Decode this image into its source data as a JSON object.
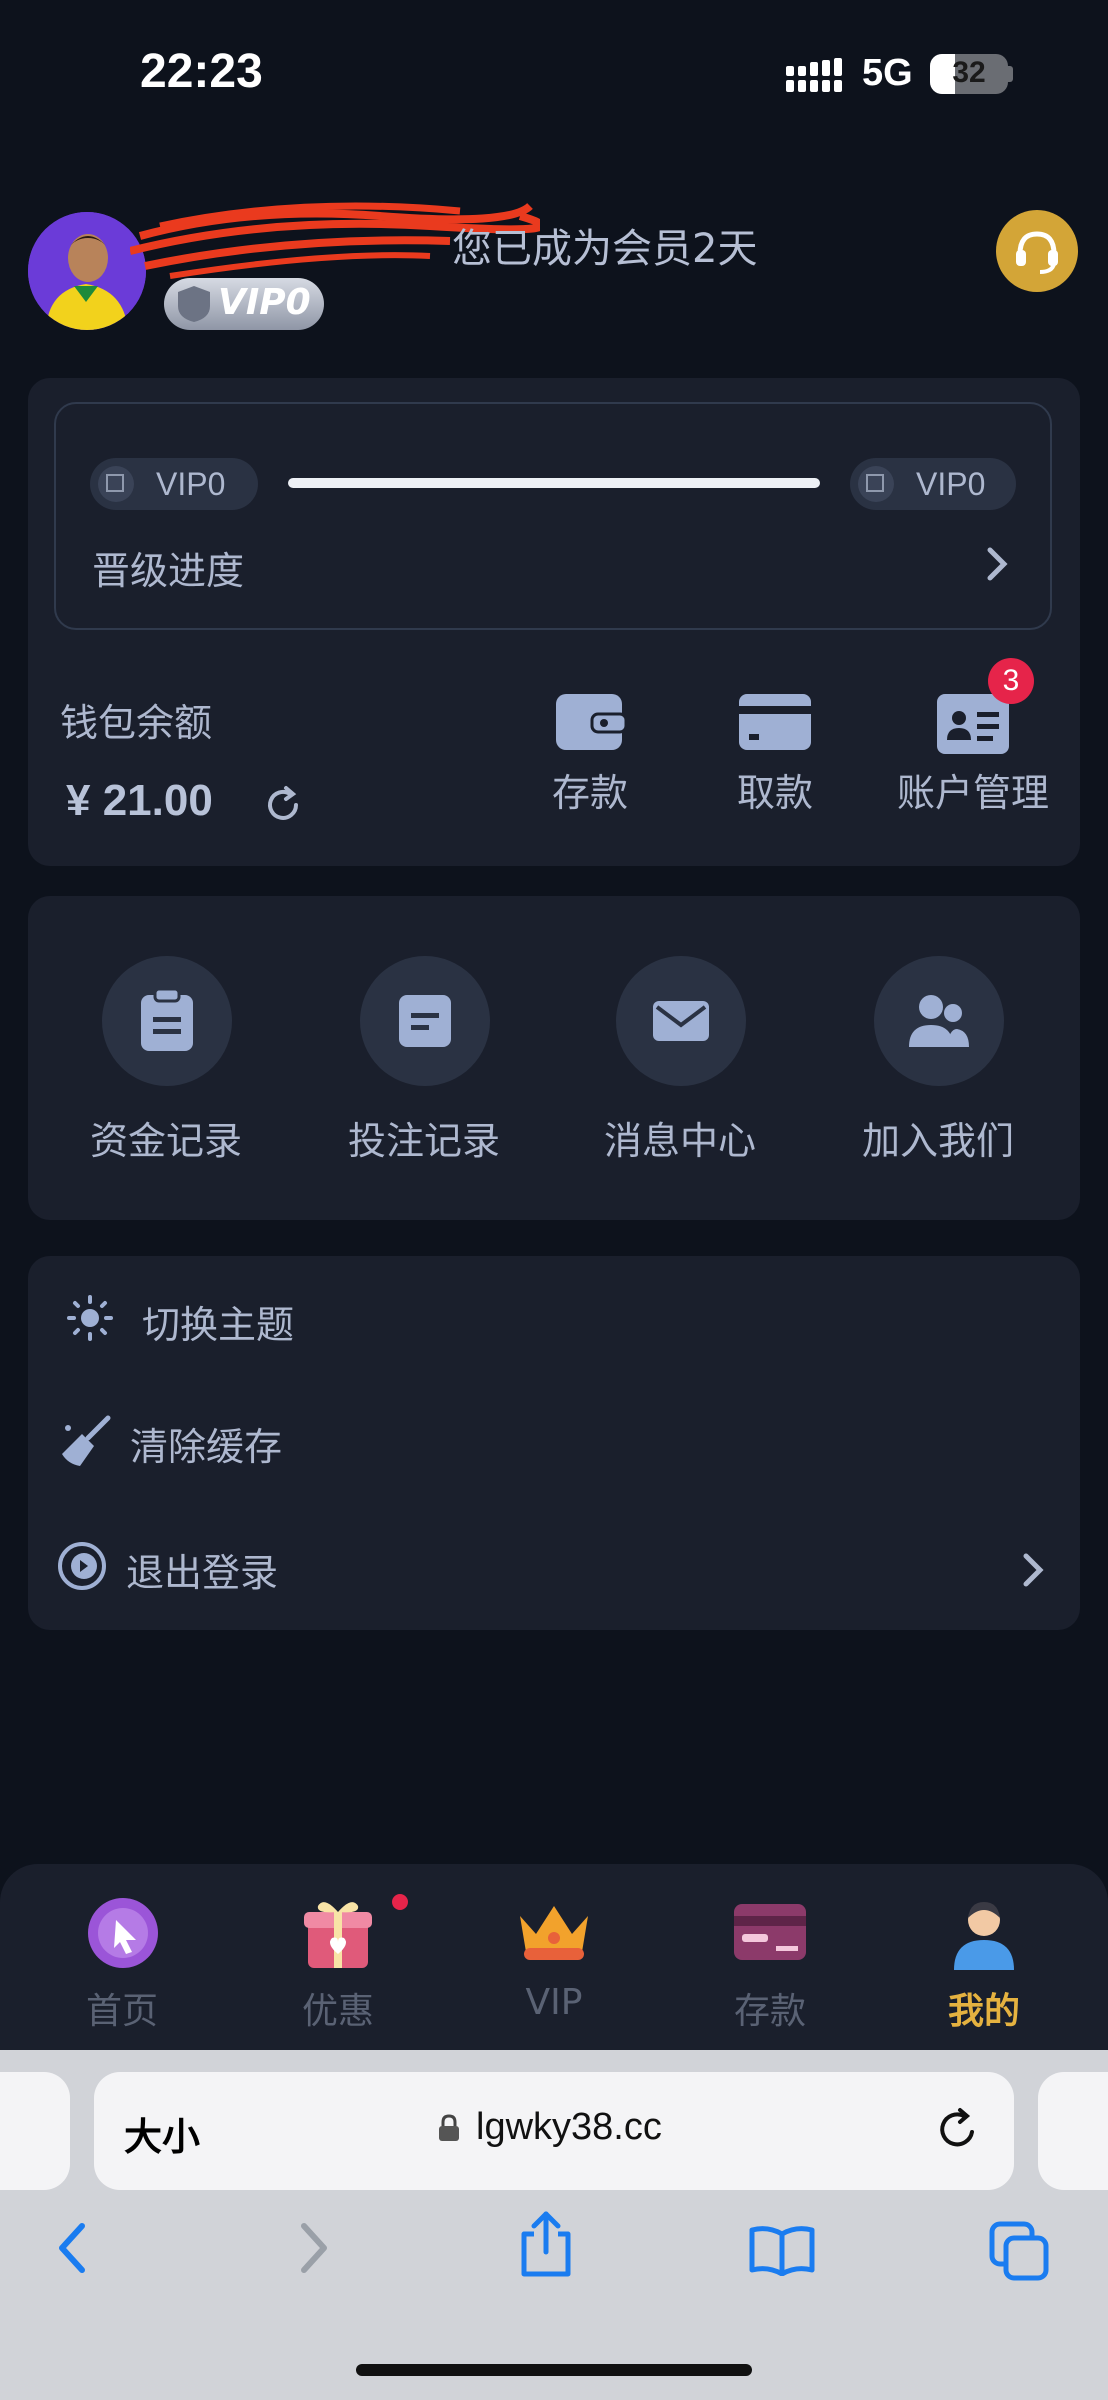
{
  "status_bar": {
    "time": "22:23",
    "network": "5G",
    "battery": "32",
    "battery_level": 0.32
  },
  "profile": {
    "member_text": "您已成为会员2天",
    "vip_badge": "VIP0",
    "avatar_icon": "avatar-photo",
    "support_icon": "headset-icon"
  },
  "vip_progress": {
    "current_level": "VIP0",
    "next_level": "VIP0",
    "label": "晋级进度",
    "progress": 0
  },
  "wallet": {
    "label": "钱包余额",
    "balance": "¥ 21.00",
    "actions": [
      {
        "label": "存款",
        "icon": "wallet-icon"
      },
      {
        "label": "取款",
        "icon": "card-icon"
      },
      {
        "label": "账户管理",
        "icon": "id-card-icon",
        "badge": "3"
      }
    ]
  },
  "records": [
    {
      "label": "资金记录",
      "icon": "clipboard-icon"
    },
    {
      "label": "投注记录",
      "icon": "document-icon"
    },
    {
      "label": "消息中心",
      "icon": "mail-icon"
    },
    {
      "label": "加入我们",
      "icon": "users-icon"
    }
  ],
  "settings": [
    {
      "label": "切换主题",
      "icon": "sun-icon"
    },
    {
      "label": "清除缓存",
      "icon": "broom-icon"
    },
    {
      "label": "退出登录",
      "icon": "logout-icon"
    }
  ],
  "tabbar": [
    {
      "label": "首页",
      "icon": "home-cursor-icon"
    },
    {
      "label": "优惠",
      "icon": "gift-icon"
    },
    {
      "label": "VIP",
      "icon": "crown-icon"
    },
    {
      "label": "存款",
      "icon": "credit-card-icon"
    },
    {
      "label": "我的",
      "icon": "person-icon",
      "active": true
    }
  ],
  "browser": {
    "text_size": "大小",
    "url": "lgwky38.cc"
  },
  "colors": {
    "background": "#0d121c",
    "card": "#1a1f2c",
    "accent": "#e5b240",
    "badge": "#e6244a"
  }
}
